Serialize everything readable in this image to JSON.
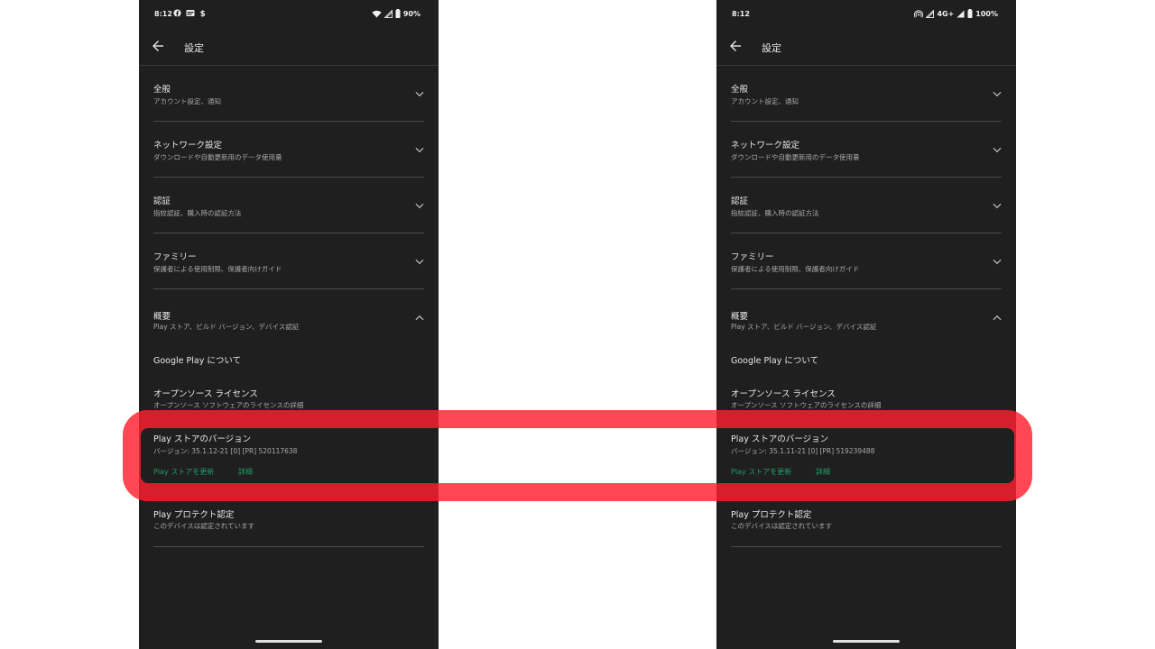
{
  "colors": {
    "phone_bg": "#1f1f1f",
    "accent_green": "#1e9e66",
    "highlight_red": "#ff202d"
  },
  "left": {
    "status": {
      "time": "8:12",
      "battery": "90%",
      "left_icons": [
        "facebook-icon",
        "notification-icon",
        "dollar-icon"
      ],
      "right_icons": [
        "wifi-icon",
        "signal-icon",
        "battery-icon"
      ]
    },
    "app_bar": {
      "title": "設定"
    },
    "sections": [
      {
        "title": "全般",
        "subtitle": "アカウント設定、通知"
      },
      {
        "title": "ネットワーク設定",
        "subtitle": "ダウンロードや自動更新用のデータ使用量"
      },
      {
        "title": "認証",
        "subtitle": "指紋認証、購入時の認証方法"
      },
      {
        "title": "ファミリー",
        "subtitle": "保護者による使用制限、保護者向けガイド"
      }
    ],
    "about": {
      "title": "概要",
      "subtitle": "Play ストア、ビルド バージョン、デバイス認証",
      "google_play": "Google Play について",
      "oss_title": "オープンソース ライセンス",
      "oss_subtitle": "オープンソース ソフトウェアのライセンスの詳細",
      "version_title": "Play ストアのバージョン",
      "version_value": "バージョン: 35.1.12-21 [0] [PR] 520117638",
      "update_action": "Play ストアを更新",
      "details_action": "詳細",
      "protect_title": "Play プロテクト認定",
      "protect_subtitle": "このデバイスは認定されています"
    }
  },
  "right": {
    "status": {
      "time": "8:12",
      "battery": "100%",
      "network": "4G+",
      "right_icons": [
        "hotspot-icon",
        "signal-icon",
        "battery-icon"
      ]
    },
    "app_bar": {
      "title": "設定"
    },
    "sections": [
      {
        "title": "全般",
        "subtitle": "アカウント設定、通知"
      },
      {
        "title": "ネットワーク設定",
        "subtitle": "ダウンロードや自動更新用のデータ使用量"
      },
      {
        "title": "認証",
        "subtitle": "指紋認証、購入時の認証方法"
      },
      {
        "title": "ファミリー",
        "subtitle": "保護者による使用制限、保護者向けガイド"
      }
    ],
    "about": {
      "title": "概要",
      "subtitle": "Play ストア、ビルド バージョン、デバイス認証",
      "google_play": "Google Play について",
      "oss_title": "オープンソース ライセンス",
      "oss_subtitle": "オープンソース ソフトウェアのライセンスの詳細",
      "version_title": "Play ストアのバージョン",
      "version_value": "バージョン: 35.1.11-21 [0] [PR] 519239488",
      "update_action": "Play ストアを更新",
      "details_action": "詳細",
      "protect_title": "Play プロテクト認定",
      "protect_subtitle": "このデバイスは認定されています"
    }
  }
}
